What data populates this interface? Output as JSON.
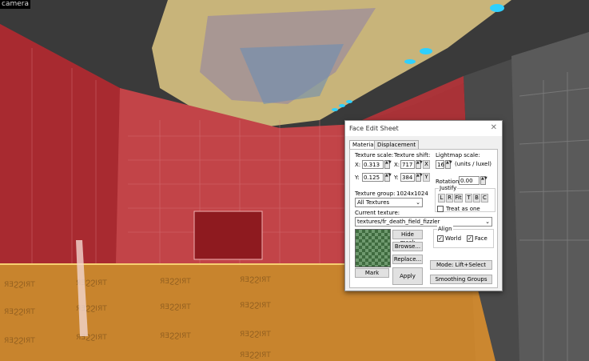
{
  "viewport": {
    "label": "camera"
  },
  "dialog": {
    "title": "Face Edit Sheet",
    "close": "✕",
    "tabs": [
      "Material",
      "Displacement"
    ],
    "texture_scale_label": "Texture scale:",
    "texture_shift_label": "Texture shift:",
    "lightmap_scale_label": "Lightmap scale:",
    "lightmap_units": "(units / luxel)",
    "x_label": "X:",
    "y_label": "Y:",
    "scale_x": "0.313",
    "scale_y": "0.125",
    "shift_x": "717",
    "shift_y": "384",
    "x_button": "X",
    "y_button": "Y",
    "lightmap_value": "16",
    "rotation_label": "Rotation:",
    "rotation_value": "0.00",
    "justify_label": "Justify",
    "justify_buttons": [
      "L",
      "R",
      "Fit",
      "T",
      "B",
      "C"
    ],
    "treat_as_one": "Treat as one",
    "texture_group_label": "Texture group:",
    "texture_size": "1024x1024",
    "texture_group_value": "All Textures",
    "current_texture_label": "Current texture:",
    "current_texture_value": "textures/fr_death_field_fizzler",
    "hide_mask": "Hide mask",
    "browse": "Browse...",
    "replace": "Replace...",
    "align_label": "Align",
    "world": "World",
    "face": "Face",
    "mode": "Mode: Lift+Select",
    "mark": "Mark",
    "apply": "Apply",
    "smoothing_groups": "Smoothing Groups"
  }
}
